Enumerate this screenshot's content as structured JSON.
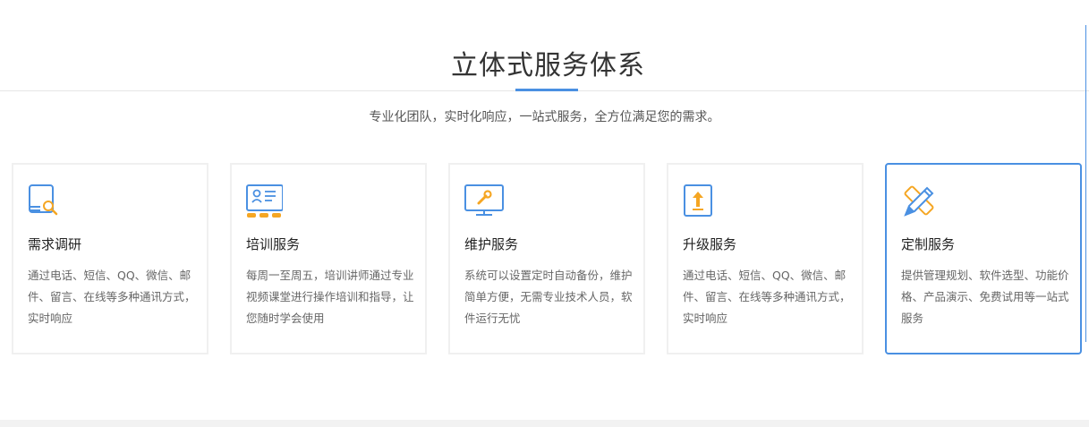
{
  "section": {
    "title": "立体式服务体系",
    "subtitle": "专业化团队，实时化响应，一站式服务，全方位满足您的需求。"
  },
  "colors": {
    "accent": "#4a90e2",
    "icon_orange": "#f5a623",
    "card_border": "#f0f0f0"
  },
  "cards": [
    {
      "title": "需求调研",
      "icon": "document-search-icon",
      "desc": "通过电话、短信、QQ、微信、邮件、留言、在线等多种通讯方式，实时响应"
    },
    {
      "title": "培训服务",
      "icon": "training-board-icon",
      "desc": "每周一至周五，培训讲师通过专业视频课堂进行操作培训和指导，让您随时学会使用"
    },
    {
      "title": "维护服务",
      "icon": "monitor-wrench-icon",
      "desc": "系统可以设置定时自动备份，维护简单方便，无需专业技术人员，软件运行无忧"
    },
    {
      "title": "升级服务",
      "icon": "upgrade-arrow-icon",
      "desc": "通过电话、短信、QQ、微信、邮件、留言、在线等多种通讯方式，实时响应"
    },
    {
      "title": "定制服务",
      "icon": "pencil-ruler-icon",
      "desc": "提供管理规划、软件选型、功能价格、产品演示、免费试用等一站式服务",
      "active": true
    }
  ]
}
